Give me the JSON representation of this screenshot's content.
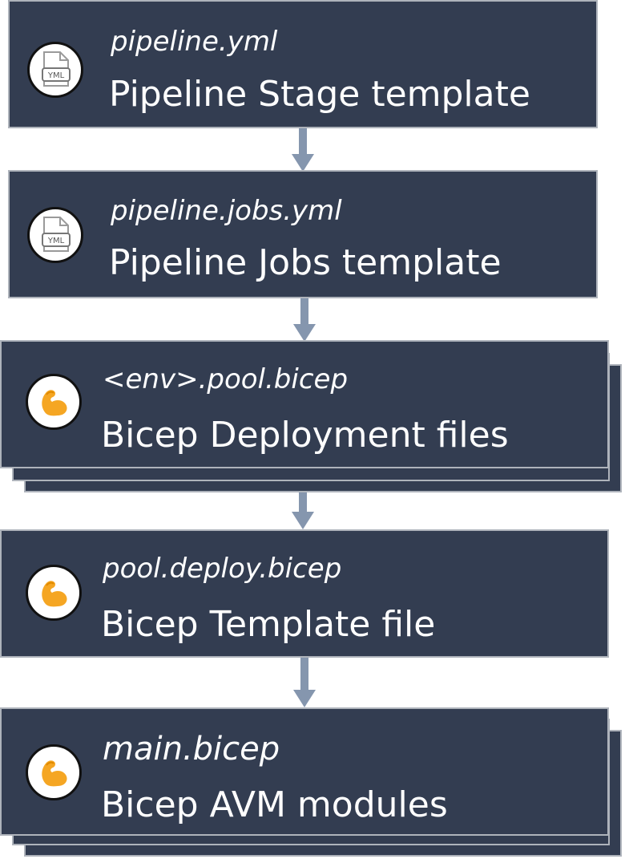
{
  "colors": {
    "box_fill": "#333d51",
    "box_border": "#aeb3bb",
    "arrow": "#8596ae",
    "text": "#ffffff",
    "bicep_icon": "#f5a623"
  },
  "nodes": [
    {
      "filename": "pipeline.yml",
      "title": "Pipeline Stage template",
      "icon": "yml-file-icon",
      "stacked": false
    },
    {
      "filename": "pipeline.jobs.yml",
      "title": "Pipeline Jobs template",
      "icon": "yml-file-icon",
      "stacked": false
    },
    {
      "filename": "<env>.pool.bicep",
      "title": "Bicep Deployment files",
      "icon": "bicep-icon",
      "stacked": true
    },
    {
      "filename": "pool.deploy.bicep",
      "title": "Bicep Template file",
      "icon": "bicep-icon",
      "stacked": false
    },
    {
      "filename": "main.bicep",
      "title": "Bicep AVM modules",
      "icon": "bicep-icon",
      "stacked": true
    }
  ],
  "yml_icon_label": "YML"
}
